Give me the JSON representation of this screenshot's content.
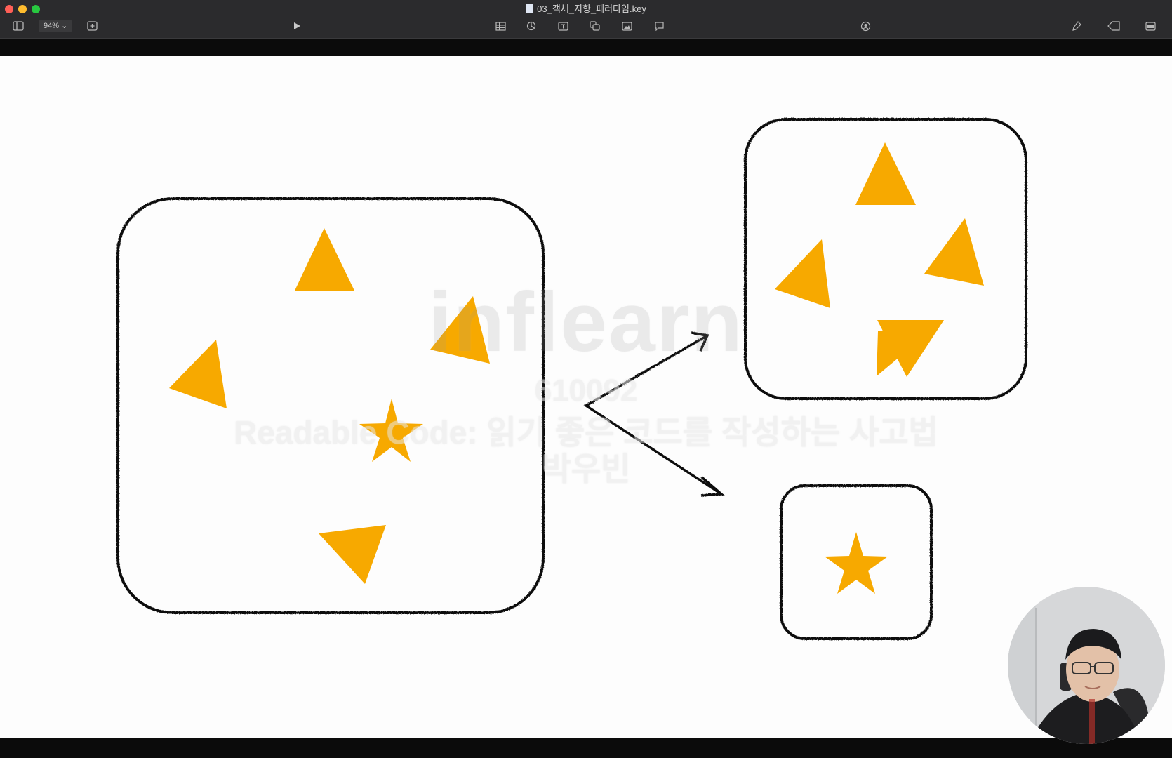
{
  "window": {
    "title": "03_객체_지향_패러다임.key"
  },
  "toolbar": {
    "zoom_value": "94%",
    "icons": [
      "sidebar-icon",
      "add-slide-icon",
      "play-icon",
      "table-icon",
      "chart-icon",
      "text-icon",
      "shape-icon",
      "media-icon",
      "comment-icon",
      "collaborate-icon",
      "format-icon",
      "animate-icon",
      "document-icon"
    ]
  },
  "colors": {
    "shape_fill": "#f7a900",
    "outline": "#111111"
  },
  "watermark": {
    "logo": "inflearn",
    "id": "610092",
    "course": "Readable Code: 읽기 좋은 코드를 작성하는 사고법",
    "author": "박우빈"
  }
}
